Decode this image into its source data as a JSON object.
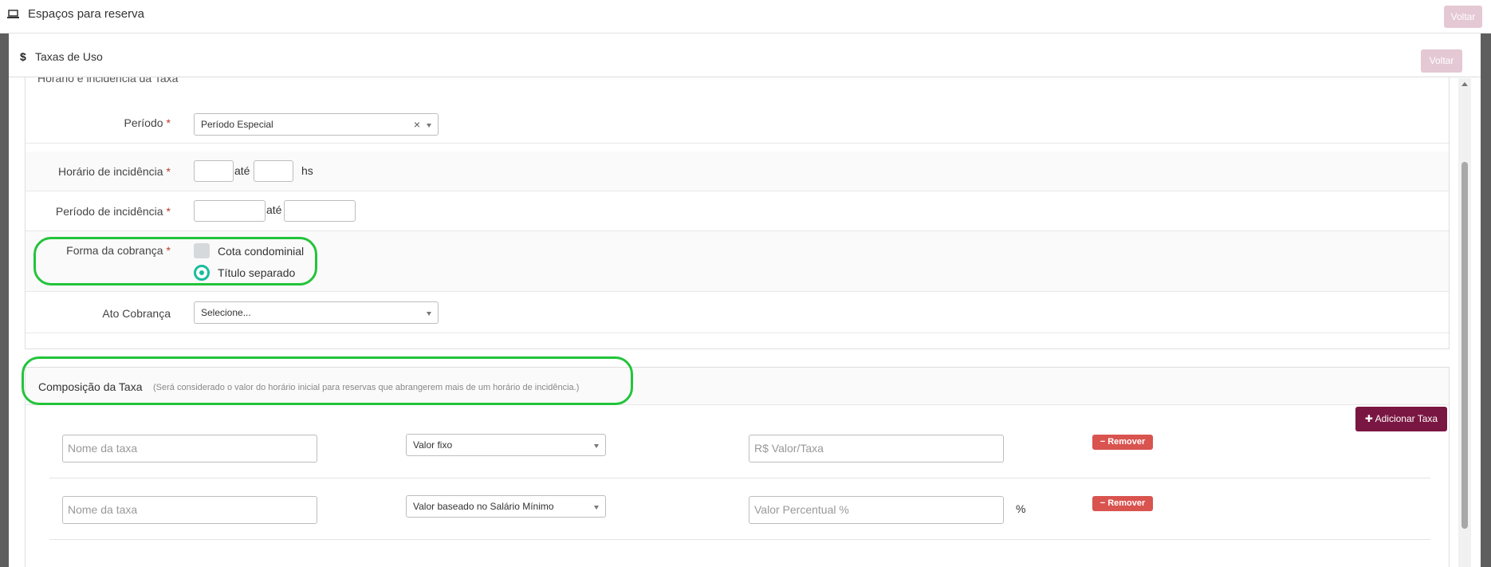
{
  "header": {
    "title": "Espaços para reserva",
    "back_label": "Voltar"
  },
  "modal": {
    "title": "Taxas de Uso",
    "back_label": "Voltar"
  },
  "section1": {
    "heading": "Horário e incidência da Taxa",
    "required_mark": "*",
    "periodo": {
      "label": "Período",
      "value": "Período Especial",
      "clear": "×"
    },
    "horario": {
      "label": "Horário de incidência",
      "sep": "até",
      "unit": "hs"
    },
    "periodo_inc": {
      "label": "Período de incidência",
      "sep": "até"
    },
    "forma": {
      "label": "Forma da cobrança",
      "opt1": "Cota condominial",
      "opt2": "Título separado",
      "selected": "Título separado"
    },
    "ato": {
      "label": "Ato Cobrança",
      "placeholder": "Selecione..."
    }
  },
  "section2": {
    "title": "Composição da Taxa",
    "note": "(Será considerado o valor do horário inicial para reservas que abrangerem mais de um horário de incidência.)",
    "add_label": "Adicionar Taxa",
    "remove_label": "Remover",
    "rows": [
      {
        "name_ph": "Nome da taxa",
        "type": "Valor fixo",
        "value_ph": "R$ Valor/Taxa",
        "suffix": ""
      },
      {
        "name_ph": "Nome da taxa",
        "type": "Valor baseado no Salário Mínimo",
        "value_ph": "Valor Percentual %",
        "suffix": "%"
      }
    ]
  },
  "colors": {
    "accent": "#7a1642",
    "remove": "#d9534f",
    "radio": "#1abc9c",
    "highlight": "#22c43a"
  }
}
